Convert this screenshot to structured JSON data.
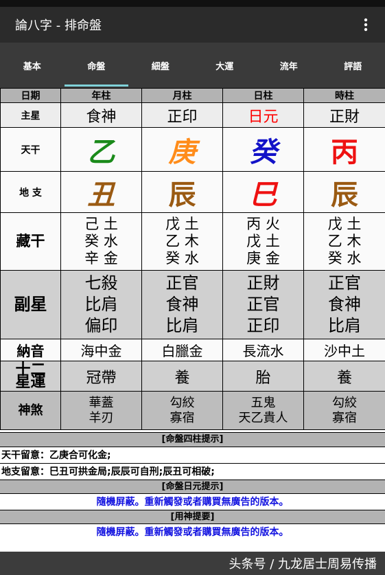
{
  "app": {
    "title": "論八字 - 排命盤"
  },
  "tabs": [
    {
      "label": "基本"
    },
    {
      "label": "命盤",
      "selected": true
    },
    {
      "label": "細盤"
    },
    {
      "label": "大運"
    },
    {
      "label": "流年"
    },
    {
      "label": "評語"
    }
  ],
  "table": {
    "headers": [
      "日期",
      "年柱",
      "月柱",
      "日柱",
      "時柱"
    ],
    "rows": {
      "zhuxing": {
        "label": "主星",
        "cells": [
          "食神",
          "正印",
          "日元",
          "正財"
        ],
        "colors": [
          "#000000",
          "#000000",
          "#ff0000",
          "#000000"
        ]
      },
      "tiangan": {
        "label": "天干",
        "cells": [
          "乙",
          "庚",
          "癸",
          "丙"
        ],
        "colors": [
          "#1a8a1a",
          "#ff8c1a",
          "#1212c8",
          "#ee1111"
        ]
      },
      "dizhi": {
        "label": "地 支",
        "cells": [
          "丑",
          "辰",
          "巳",
          "辰"
        ],
        "colors": [
          "#9a5a12",
          "#9a5a12",
          "#ee1111",
          "#9a5a12"
        ]
      },
      "canggan": {
        "label": "藏干",
        "cells": [
          [
            "己 土",
            "癸 水",
            "辛 金"
          ],
          [
            "戊 土",
            "乙 木",
            "癸 水"
          ],
          [
            "丙 火",
            "戊 土",
            "庚 金"
          ],
          [
            "戊 土",
            "乙 木",
            "癸 水"
          ]
        ]
      },
      "fuxing": {
        "label": "副星",
        "cells": [
          [
            "七殺",
            "比肩",
            "偏印"
          ],
          [
            "正官",
            "食神",
            "比肩"
          ],
          [
            "正財",
            "正官",
            "正印"
          ],
          [
            "正官",
            "食神",
            "比肩"
          ]
        ]
      },
      "nayin": {
        "label": "納音",
        "cells": [
          "海中金",
          "白臘金",
          "長流水",
          "沙中土"
        ]
      },
      "xingyun": {
        "label_top": "十二",
        "label_bottom": "星運",
        "cells": [
          "冠帶",
          "養",
          "胎",
          "養"
        ]
      },
      "shensha": {
        "label": "神煞",
        "cells": [
          [
            "華蓋",
            "羊刃"
          ],
          [
            "勾絞",
            "寡宿"
          ],
          [
            "五鬼",
            "天乙貴人"
          ],
          [
            "勾絞",
            "寡宿"
          ]
        ]
      }
    }
  },
  "sections": {
    "sizhu_title": "[命盤四柱提示]",
    "tiangan_note": "天干留意：乙庚合可化金;",
    "dizhi_note": "地支留意：巳丑可拱金局;辰辰可自刑;辰丑可相破;",
    "riyuan_title": "[命盤日元提示]",
    "riyuan_body": "隨機屏蔽。重新觸發或者購買無廣告的版本。",
    "yongshen_title": "[用神提要]",
    "yongshen_body": "隨機屏蔽。重新觸發或者購買無廣告的版本。"
  },
  "watermark": "头条号 / 九龙居士周易传播",
  "colors": {
    "link_blue": "#1313e0",
    "accent": "#7fd1d8"
  }
}
